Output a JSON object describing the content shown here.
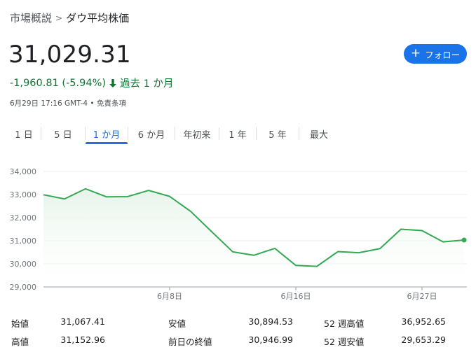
{
  "breadcrumb": {
    "parent": "市場概説",
    "separator": ">",
    "current": "ダウ平均株価"
  },
  "quote": {
    "price": "31,029.31",
    "change": "-1,960.81 (-5.94%)",
    "period": "過去 1 か月",
    "timestamp": "6月29日 17:16 GMT-4 • 免責条項"
  },
  "follow_button": {
    "label": "フォロー",
    "icon": "plus-icon",
    "color": "#1a73e8"
  },
  "range_tabs": [
    {
      "label": "1 日",
      "active": false
    },
    {
      "label": "5 日",
      "active": false
    },
    {
      "label": "1 か月",
      "active": true
    },
    {
      "label": "6 か月",
      "active": false
    },
    {
      "label": "年初来",
      "active": false
    },
    {
      "label": "1 年",
      "active": false
    },
    {
      "label": "5 年",
      "active": false
    },
    {
      "label": "最大",
      "active": false
    }
  ],
  "chart_data": {
    "type": "area",
    "title": "",
    "xlabel": "",
    "ylabel": "",
    "ylim": [
      29000,
      34000
    ],
    "y_ticks": [
      "29,000",
      "30,000",
      "31,000",
      "32,000",
      "33,000",
      "34,000"
    ],
    "x_tick_labels": [
      {
        "label": "6月8日",
        "index": 6
      },
      {
        "label": "6月16日",
        "index": 12
      },
      {
        "label": "6月27日",
        "index": 18
      }
    ],
    "series": [
      {
        "values": [
          32990,
          32810,
          33250,
          32900,
          32910,
          33180,
          32920,
          32270,
          31390,
          30520,
          30370,
          30670,
          29930,
          29890,
          30530,
          30480,
          30660,
          31500,
          31440,
          30950,
          31029
        ]
      }
    ],
    "grid": true,
    "line_color": "#34a853",
    "fill_color": "#e6f4ea"
  },
  "stats": [
    {
      "label": "始値",
      "value": "31,067.41"
    },
    {
      "label": "高値",
      "value": "31,152.96"
    },
    {
      "label": "安値",
      "value": "30,894.53"
    },
    {
      "label": "前日の終値",
      "value": "30,946.99"
    },
    {
      "label": "52 週高値",
      "value": "36,952.65"
    },
    {
      "label": "52 週安値",
      "value": "29,653.29"
    }
  ]
}
